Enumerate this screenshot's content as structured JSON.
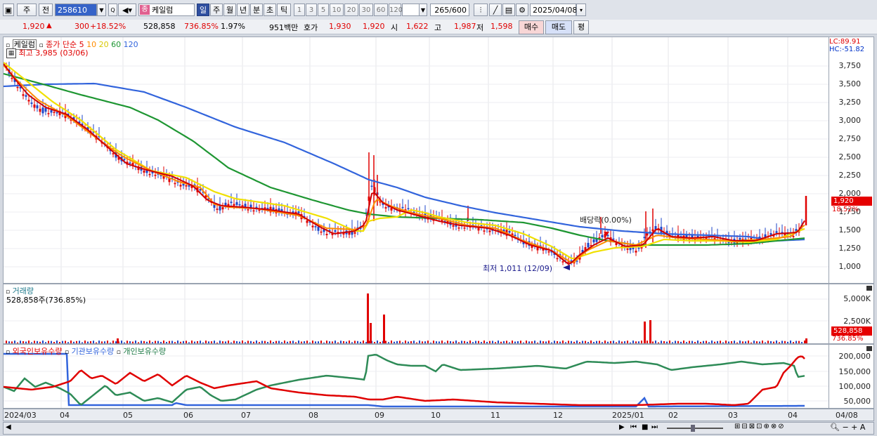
{
  "toolbar": {
    "type1": "주",
    "type2": "전",
    "code": "258610",
    "name": "케일럼",
    "name_badge": "종",
    "periods": [
      "일",
      "주",
      "월",
      "년",
      "분",
      "초",
      "틱"
    ],
    "numbers": [
      "1",
      "3",
      "5",
      "10",
      "20",
      "30",
      "60",
      "120"
    ],
    "count": "265",
    "total": "/600",
    "date": "2025/04/08"
  },
  "quote": {
    "price": "1,920",
    "arrow": "▲",
    "change": "300",
    "change_pct": "+18.52%",
    "volume": "528,858",
    "volume_pct": "736.85%",
    "turnover": "1.97%",
    "amount": "951백만",
    "ask_label": "호가",
    "ask": "1,930",
    "bid": "1,920",
    "open_label": "시",
    "open": "1,622",
    "high_label": "고",
    "high": "1,987",
    "low_label": "저",
    "low": "1,598",
    "buy": "매수",
    "sell": "매도",
    "eval": "평"
  },
  "price_panel": {
    "name": "케일럼",
    "ma_title": "종가 단순",
    "ma": [
      "5",
      "10",
      "20",
      "60",
      "120"
    ],
    "ma_colors": [
      "#e00000",
      "#ff8c00",
      "#f0e000",
      "#1e9632",
      "#3264dc"
    ],
    "high_label": "최고 3,985 (03/06)",
    "low_label": "최저 1,011 (12/09)",
    "dividend_label": "배당락(0.00%)",
    "lc": "LC:89.91",
    "hc": "HC:-51.82",
    "last": "1,920",
    "last_pct": "18.52%",
    "yticks": [
      "3,750",
      "3,500",
      "3,250",
      "3,000",
      "2,750",
      "2,500",
      "2,250",
      "2,000",
      "1,750",
      "1,500",
      "1,250",
      "1,000"
    ]
  },
  "volume_panel": {
    "title": "거래량",
    "value": "528,858주(736.85%)",
    "yticks": [
      "5,000K",
      "2,500K"
    ],
    "last": "528,858",
    "last_pct": "736.85%"
  },
  "holding_panel": {
    "series": [
      "외국인보유수량",
      "기관보유수량",
      "개인보유수량"
    ],
    "yticks": [
      "200,000",
      "150,000",
      "100,000",
      "50,000"
    ]
  },
  "xaxis": [
    "2024/03",
    "04",
    "05",
    "06",
    "07",
    "08",
    "09",
    "10",
    "11",
    "12",
    "2025/01",
    "02",
    "03",
    "04",
    "04/08"
  ]
}
